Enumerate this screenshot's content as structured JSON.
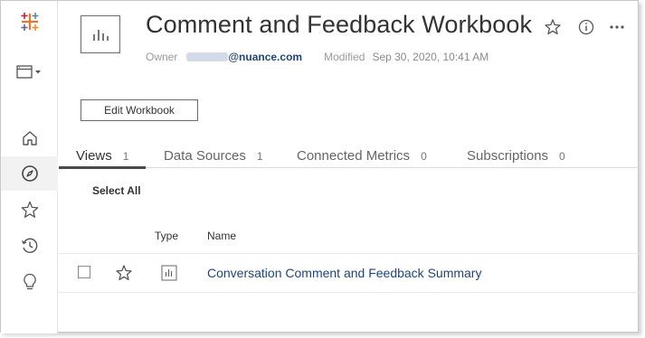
{
  "header": {
    "title": "Comment and Feedback Workbook",
    "owner_label": "Owner",
    "owner_email": "@nuance.com",
    "modified_label": "Modified",
    "modified_value": "Sep 30, 2020, 10:41 AM",
    "edit_button": "Edit Workbook"
  },
  "tabs": [
    {
      "label": "Views",
      "count": "1"
    },
    {
      "label": "Data Sources",
      "count": "1"
    },
    {
      "label": "Connected Metrics",
      "count": "0"
    },
    {
      "label": "Subscriptions",
      "count": "0"
    }
  ],
  "table": {
    "select_all": "Select All",
    "columns": {
      "type": "Type",
      "name": "Name"
    },
    "rows": [
      {
        "name": "Conversation Comment and Feedback Summary"
      }
    ]
  },
  "sidebar": {
    "icons": [
      "tableau-logo-icon",
      "browse-menu-icon",
      "home-icon",
      "explore-compass-icon",
      "favorites-star-icon",
      "recents-clock-icon",
      "recommendations-bulb-icon"
    ]
  },
  "colors": {
    "link": "#1f457e",
    "tab_active_underline": "#4a4a4a",
    "sidebar_active_bg": "#f2f2f2"
  }
}
